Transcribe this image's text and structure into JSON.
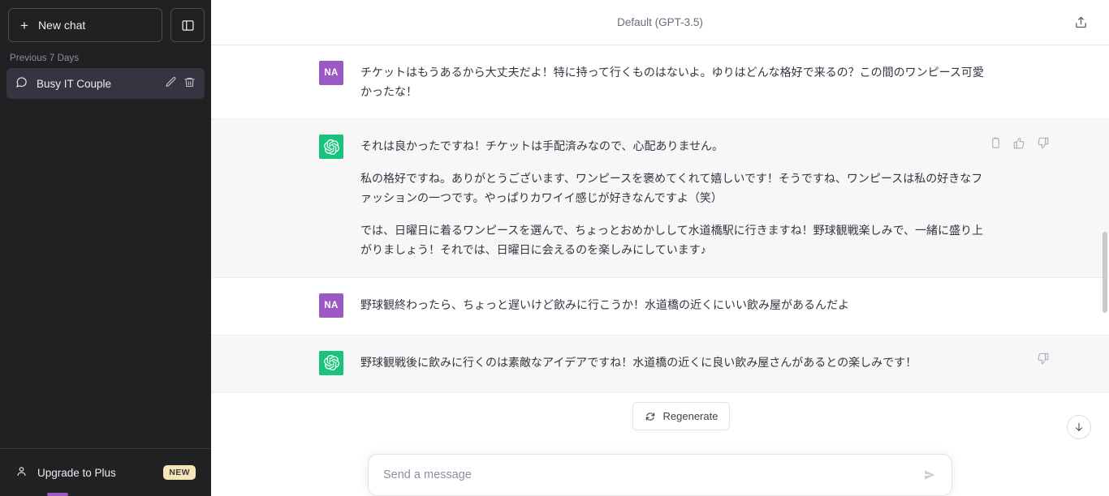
{
  "sidebar": {
    "new_chat_label": "New chat",
    "new_chat_icon": "plus-icon",
    "panel_toggle_icon": "sidebar-panel-icon",
    "section_label": "Previous 7 Days",
    "chats": [
      {
        "title": "Busy IT Couple",
        "icon": "chat-bubble-icon",
        "edit_icon": "pencil-icon",
        "delete_icon": "trash-icon",
        "active": true
      }
    ],
    "upgrade": {
      "label": "Upgrade to Plus",
      "icon": "person-icon",
      "badge": "NEW",
      "badge_color": "#f5e6b8"
    }
  },
  "header": {
    "model_title": "Default (GPT-3.5)",
    "share_icon": "share-upload-icon"
  },
  "conversation": {
    "messages": [
      {
        "role": "user",
        "avatar_initials": "NA",
        "avatar_color": "#9b59c4",
        "paragraphs": [
          "チケットはもうあるから大丈夫だよ！特に持って行くものはないよ。ゆりはどんな格好で来るの？この間のワンピース可愛かったな！"
        ]
      },
      {
        "role": "assistant",
        "avatar_icon": "openai-logo-icon",
        "avatar_color": "#19c37d",
        "paragraphs": [
          "それは良かったですね！チケットは手配済みなので、心配ありません。",
          "私の格好ですね。ありがとうございます、ワンピースを褒めてくれて嬉しいです！そうですね、ワンピースは私の好きなファッションの一つです。やっぱりカワイイ感じが好きなんですよ（笑）",
          "では、日曜日に着るワンピースを選んで、ちょっとおめかしして水道橋駅に行きますね！野球観戦楽しみで、一緒に盛り上がりましょう！それでは、日曜日に会えるのを楽しみにしています♪"
        ],
        "actions": [
          "copy-icon",
          "thumbs-up-icon",
          "thumbs-down-icon"
        ]
      },
      {
        "role": "user",
        "avatar_initials": "NA",
        "avatar_color": "#9b59c4",
        "paragraphs": [
          "野球観終わったら、ちょっと遅いけど飲みに行こうか！水道橋の近くにいい飲み屋があるんだよ"
        ]
      },
      {
        "role": "assistant",
        "avatar_icon": "openai-logo-icon",
        "avatar_color": "#19c37d",
        "paragraphs": [
          "野球観戦後に飲みに行くのは素敵なアイデアですね！水道橋の近くに良い飲み屋さんがあるとの楽しみです！"
        ],
        "actions": [
          "thumbs-down-icon"
        ]
      }
    ]
  },
  "footer": {
    "regenerate_label": "Regenerate",
    "regenerate_icon": "refresh-icon",
    "composer_placeholder": "Send a message",
    "composer_value": "",
    "send_icon": "send-arrow-icon",
    "scroll_bottom_icon": "arrow-down-icon"
  }
}
